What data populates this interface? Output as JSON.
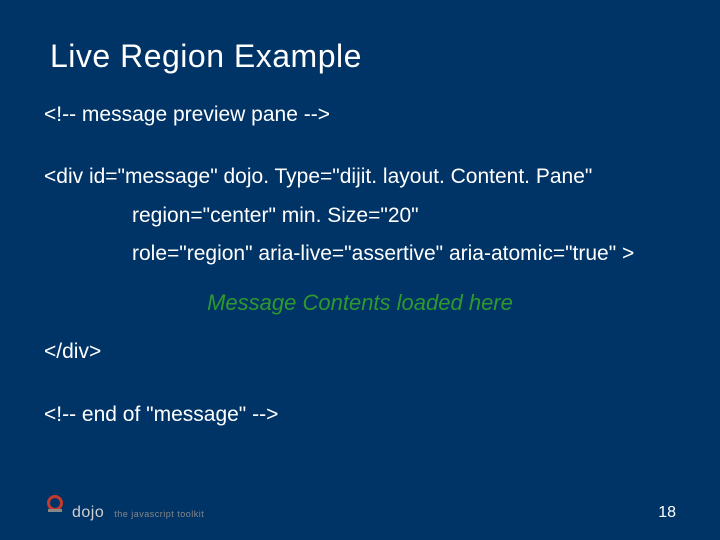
{
  "title": "Live Region Example",
  "code": {
    "l1": "<!-- message preview pane -->",
    "l2": "<div id=\"message\" dojo. Type=\"dijit. layout. Content. Pane\"",
    "l3": "region=\"center\" min. Size=\"20\"",
    "l4": "role=\"region\" aria-live=\"assertive\" aria-atomic=\"true\" >",
    "l5": "Message Contents loaded here",
    "l6": "</div>",
    "l7": "<!-- end of \"message\" -->"
  },
  "footer": {
    "logo_text": "dojo",
    "logo_sub": "the javascript toolkit",
    "page": "18"
  }
}
